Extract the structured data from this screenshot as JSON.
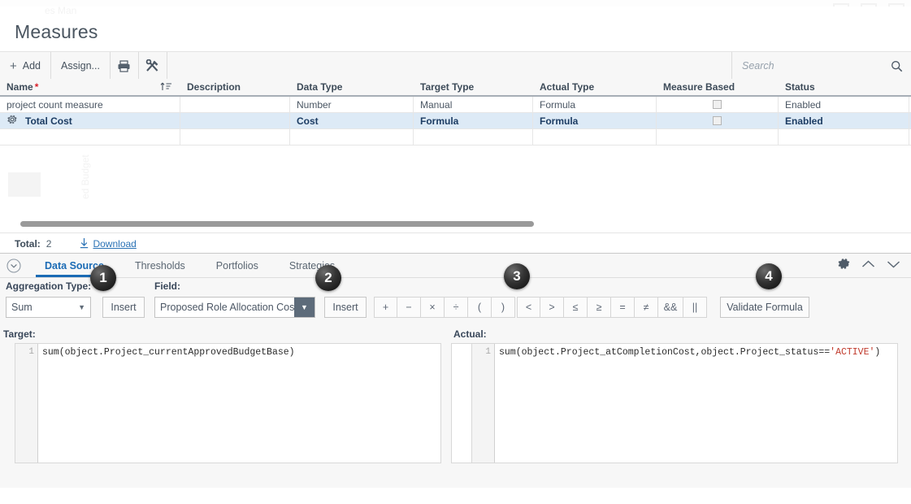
{
  "window": {
    "ghost_tab": "es Man",
    "icons": [
      "window-icon-1",
      "window-icon-2",
      "window-icon-3"
    ]
  },
  "header": {
    "title": "Measures"
  },
  "toolbar": {
    "add_label": "Add",
    "add_plus": "+",
    "assign_label": "Assign...",
    "print_icon": "printer-icon",
    "tools_icon": "tools-icon",
    "search_placeholder": "Search",
    "search_value": "",
    "search_icon": "search-icon"
  },
  "grid": {
    "columns": [
      {
        "label": "Name",
        "required": true
      },
      {
        "label": "Description",
        "required": false
      },
      {
        "label": "Data Type",
        "required": false
      },
      {
        "label": "Target Type",
        "required": false
      },
      {
        "label": "Actual Type",
        "required": false
      },
      {
        "label": "Measure Based",
        "required": false
      },
      {
        "label": "Status",
        "required": false
      }
    ],
    "sort_icon": "sort-ascending-icon",
    "rows": [
      {
        "name": "project count measure",
        "description": "",
        "data_type": "Number",
        "target_type": "Manual",
        "actual_type": "Formula",
        "measure_based": false,
        "status": "Enabled",
        "selected": false,
        "has_gear": false
      },
      {
        "name": "Total Cost",
        "description": "",
        "data_type": "Cost",
        "target_type": "Formula",
        "actual_type": "Formula",
        "measure_based": false,
        "status": "Enabled",
        "selected": true,
        "has_gear": true,
        "gear_icon": "gear-icon"
      }
    ],
    "ghost_text": "ed Budget"
  },
  "total_bar": {
    "total_label": "Total:",
    "total_value": "2",
    "download_label": "Download",
    "download_icon": "download-icon"
  },
  "panel": {
    "collapse_icon": "chevron-circle-icon",
    "tabs": [
      {
        "label": "Data Source",
        "active": true
      },
      {
        "label": "Thresholds",
        "active": false
      },
      {
        "label": "Portfolios",
        "active": false
      },
      {
        "label": "Strategies",
        "active": false
      }
    ],
    "right_controls": [
      {
        "icon": "gear-icon"
      },
      {
        "icon": "chevron-up-icon"
      },
      {
        "icon": "chevron-down-icon"
      }
    ],
    "aggregation_label": "Aggregation Type:",
    "aggregation_value": "Sum",
    "field_label": "Field:",
    "field_value": "Proposed Role Allocation Cost",
    "insert_label_1": "Insert",
    "insert_label_2": "Insert",
    "dropdown_caret": "▼",
    "operators_math": [
      "+",
      "−",
      "×",
      "÷",
      "(",
      ")"
    ],
    "operators_logic": [
      "<",
      ">",
      "≤",
      "≥",
      "=",
      "≠",
      "&&",
      "||"
    ],
    "validate_label": "Validate Formula",
    "target_label": "Target:",
    "actual_label": "Actual:",
    "target_editor": {
      "line_numbers": [
        "1"
      ],
      "code": "sum(object.Project_currentApprovedBudgetBase)"
    },
    "actual_editor": {
      "line_numbers": [
        "1"
      ],
      "code_plain_1": "sum(object.Project_atCompletionCost,object.Project_status==",
      "code_string": "'ACTIVE'",
      "code_plain_2": ")"
    }
  },
  "badges": [
    {
      "number": "1"
    },
    {
      "number": "2"
    },
    {
      "number": "3"
    },
    {
      "number": "4"
    }
  ],
  "colors": {
    "accent_blue": "#1b6bb5",
    "selected_row": "#ddeaf6",
    "link_blue": "#2a72b5",
    "required_red": "#d9202a",
    "string_red": "#c0392b",
    "dropdown_dark": "#5d6b7a"
  }
}
